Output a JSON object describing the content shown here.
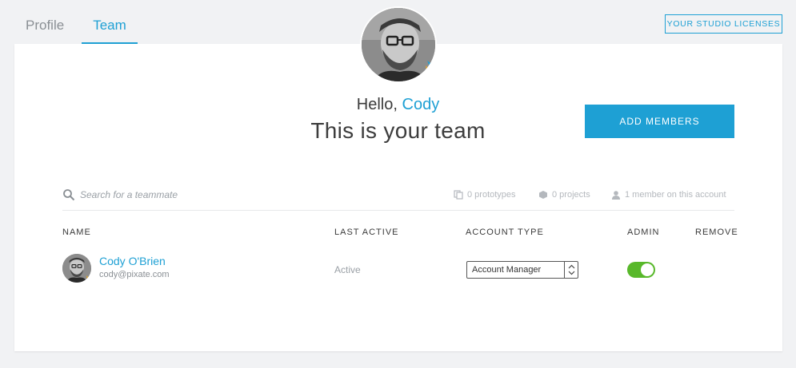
{
  "tabs": [
    {
      "label": "Profile",
      "active": false
    },
    {
      "label": "Team",
      "active": true
    }
  ],
  "header": {
    "licenses_label": "YOUR STUDIO LICENSES",
    "greeting": "Hello,",
    "user_name": "Cody",
    "title": "This is your team",
    "add_members_label": "ADD MEMBERS"
  },
  "search": {
    "placeholder": "Search for a teammate",
    "value": ""
  },
  "stats": {
    "prototypes": "0 prototypes",
    "projects": "0 projects",
    "members": "1 member on this account"
  },
  "table": {
    "columns": [
      "NAME",
      "LAST ACTIVE",
      "ACCOUNT TYPE",
      "ADMIN",
      "REMOVE"
    ],
    "rows": [
      {
        "name": "Cody O'Brien",
        "email": "cody@pixate.com",
        "last_active": "Active",
        "account_type": "Account Manager",
        "admin": true
      }
    ]
  },
  "colors": {
    "accent": "#1ea0d4",
    "toggle_on": "#58b82a",
    "background": "#f1f2f4"
  }
}
